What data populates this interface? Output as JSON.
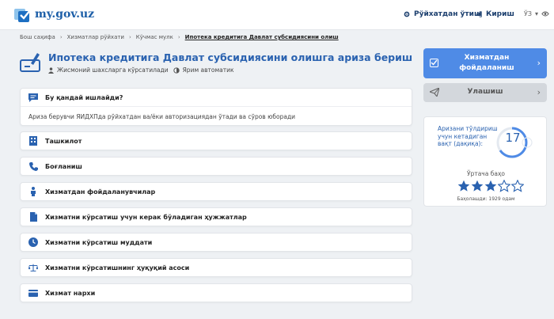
{
  "header": {
    "logo_text": "my.gov.uz",
    "register_label": "Рўйхатдан ўтиш",
    "login_label": "Кириш",
    "lang_label": "ЎЗ"
  },
  "breadcrumb": {
    "items": [
      "Бош саҳифа",
      "Хизматлар рўйхати",
      "Кўчмас мулк"
    ],
    "current": "Ипотека кредитига Давлат субсидиясини олиш"
  },
  "page": {
    "title": "Ипотека кредитига Давлат субсидиясини олишга ариза бериш",
    "audience": "Жисмоний шахсларга кўрсатилади",
    "mode": "Ярим автоматик"
  },
  "sections": [
    {
      "id": "how",
      "label": "Бу қандай ишлайди?",
      "icon": "chat-icon",
      "body": "Ариза берувчи ЯИДХПда рўйхатдан ва/ёки авторизациядан ўтади ва сўров юборади"
    },
    {
      "id": "org",
      "label": "Ташкилот",
      "icon": "building-icon"
    },
    {
      "id": "contact",
      "label": "Боғланиш",
      "icon": "phone-icon"
    },
    {
      "id": "users",
      "label": "Хизматдан фойдаланувчилар",
      "icon": "person-icon"
    },
    {
      "id": "docs",
      "label": "Хизматни кўрсатиш учун керак бўладиган ҳужжатлар",
      "icon": "document-icon"
    },
    {
      "id": "term",
      "label": "Хизматни кўрсатиш муддати",
      "icon": "clock-icon"
    },
    {
      "id": "legal",
      "label": "Хизматни кўрсатишнинг ҳуқуқий асоси",
      "icon": "scales-icon"
    },
    {
      "id": "price",
      "label": "Хизмат нархи",
      "icon": "card-icon"
    }
  ],
  "actions": {
    "use_label": "Хизматдан фойдаланиш",
    "send_label": "Улашиш"
  },
  "stats": {
    "time_label": "Аризани тўлдириш учун кетадиган вақт (дақиқа):",
    "time_value": "17",
    "rating_label": "Ўртача баҳо",
    "rating": 3,
    "rating_max": 5,
    "votes_label": "Баҳолашди: 1929 одам"
  },
  "colors": {
    "accent": "#4f8be6",
    "title": "#2a62b0",
    "icon": "#2a62b0"
  }
}
